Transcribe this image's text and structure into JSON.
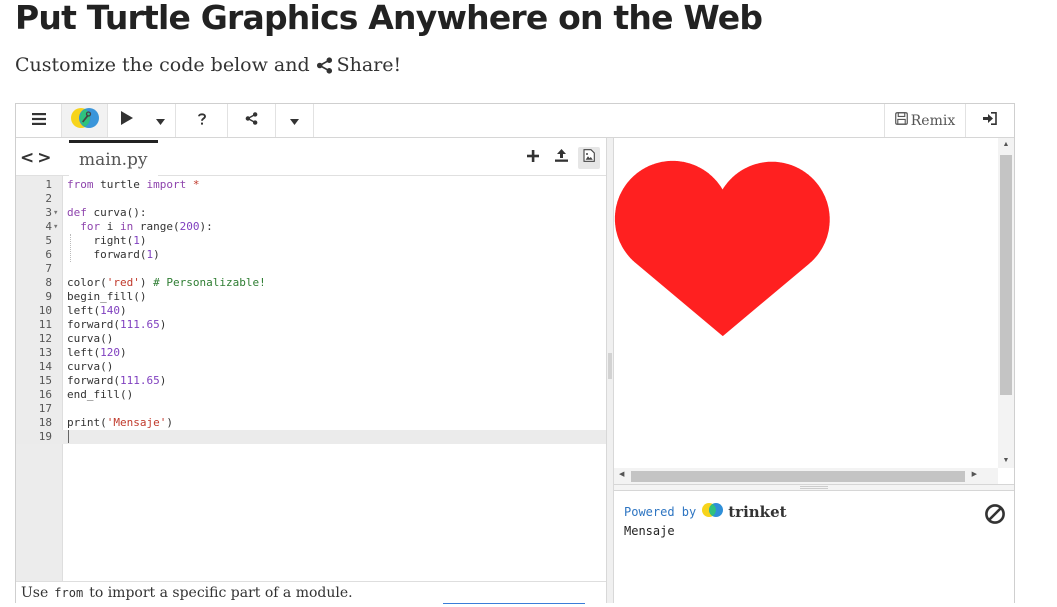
{
  "page": {
    "title": "Put Turtle Graphics Anywhere on the Web",
    "subtitle_before": "Customize the code below and",
    "subtitle_share": "Share!"
  },
  "toolbar": {
    "remix_label": "Remix"
  },
  "editor": {
    "filename": "main.py",
    "lines": [
      {
        "n": "1",
        "fold": "",
        "code": "from turtle import *"
      },
      {
        "n": "2",
        "fold": "",
        "code": ""
      },
      {
        "n": "3",
        "fold": "▾",
        "code": "def curva():"
      },
      {
        "n": "4",
        "fold": "▾",
        "code": "  for i in range(200):"
      },
      {
        "n": "5",
        "fold": "",
        "code": "    right(1)"
      },
      {
        "n": "6",
        "fold": "",
        "code": "    forward(1)"
      },
      {
        "n": "7",
        "fold": "",
        "code": ""
      },
      {
        "n": "8",
        "fold": "",
        "code": "color('red') # Personalizable!"
      },
      {
        "n": "9",
        "fold": "",
        "code": "begin_fill()"
      },
      {
        "n": "10",
        "fold": "",
        "code": "left(140)"
      },
      {
        "n": "11",
        "fold": "",
        "code": "forward(111.65)"
      },
      {
        "n": "12",
        "fold": "",
        "code": "curva()"
      },
      {
        "n": "13",
        "fold": "",
        "code": "left(120)"
      },
      {
        "n": "14",
        "fold": "",
        "code": "curva()"
      },
      {
        "n": "15",
        "fold": "",
        "code": "forward(111.65)"
      },
      {
        "n": "16",
        "fold": "",
        "code": "end_fill()"
      },
      {
        "n": "17",
        "fold": "",
        "code": ""
      },
      {
        "n": "18",
        "fold": "",
        "code": "print('Mensaje')"
      },
      {
        "n": "19",
        "fold": "",
        "code": ""
      }
    ],
    "hint_before": "Use",
    "hint_code": "from",
    "hint_after": "to import a specific part of a module."
  },
  "output": {
    "powered_by": "Powered by",
    "brand": "trinket",
    "console_text": "Mensaje",
    "heart_color": "#ff2020"
  },
  "colors": {
    "keyword": "#8e44ad",
    "string": "#c0392b",
    "comment": "#2e7d32",
    "number": "#7f3fbf",
    "brand_yellow": "#f7d41c",
    "brand_blue": "#2f8fd8",
    "brand_green": "#2ec27e"
  },
  "icons": {
    "menu": "hamburger-icon",
    "logo": "trinket-logo-icon",
    "run": "play-icon",
    "help": "question-icon",
    "share": "share-icon",
    "remix": "save-icon",
    "login": "login-icon",
    "add_file": "plus-icon",
    "upload": "upload-icon",
    "image": "image-icon",
    "stop": "stop-icon"
  }
}
